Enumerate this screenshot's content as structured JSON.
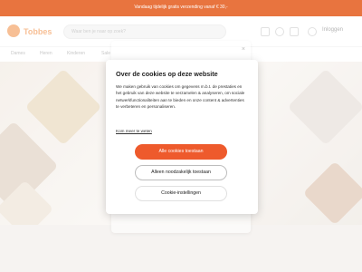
{
  "topbar": {
    "text": "Vandaag tijdelijk gratis verzending vanaf € 30,-"
  },
  "header": {
    "logo": "Tobbes",
    "search_placeholder": "Waar ben je naar op zoek?",
    "login_label": "Inloggen"
  },
  "nav": {
    "items": [
      "Dames",
      "Heren",
      "Kinderen",
      "Sale"
    ]
  },
  "ghost": {
    "close": "×"
  },
  "cookie_modal": {
    "title": "Over de cookies op deze website",
    "body": "We maken gebruik van cookies om gegevens m.b.t. de prestaties en het gebruik van deze website te verzamelen & analyseren, om sociale netwerkfunctionaliteiten aan te bieden en onze content & advertenties te verbeteren en personaliseren.",
    "more_link": "Kom meer te weten",
    "accept_all": "Alle cookies toestaan",
    "necessary_only": "Alleen noodzakelijk toestaan",
    "settings": "Cookie-instellingen"
  },
  "colors": {
    "accent": "#ee5a2c",
    "topbar": "#e8743f",
    "logo": "#f08a3e"
  }
}
